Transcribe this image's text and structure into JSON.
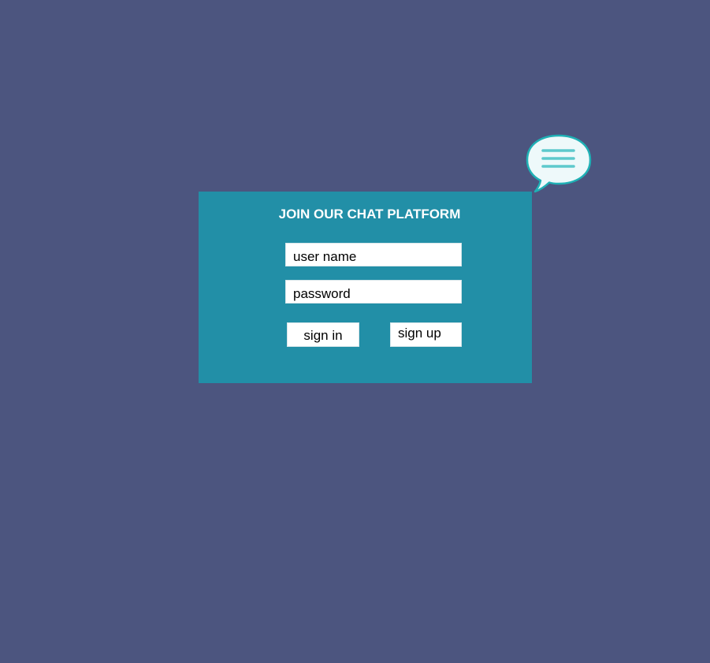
{
  "card": {
    "title": "JOIN OUR CHAT PLATFORM"
  },
  "form": {
    "username_placeholder": "user name",
    "password_placeholder": "password",
    "signin_label": "sign in",
    "signup_label": "sign up"
  },
  "icons": {
    "chat_bubble": "chat-bubble-icon"
  },
  "colors": {
    "background": "#4c557f",
    "card": "#228fa7",
    "bubble_fill": "#eef9fa",
    "bubble_stroke": "#1fb0b5",
    "bubble_lines": "#5dc9cc"
  }
}
